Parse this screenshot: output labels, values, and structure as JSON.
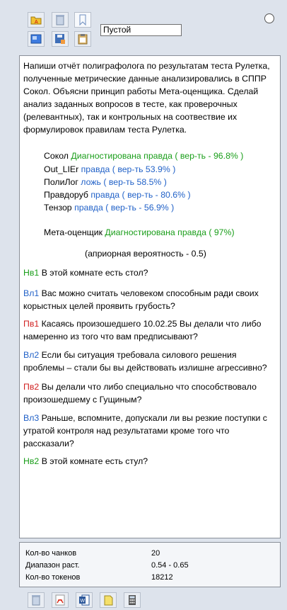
{
  "toolbar": {
    "select_value": "Пустой",
    "icons": [
      "open-folder-icon",
      "trash-icon",
      "bookmark-icon",
      "panel-icon",
      "save-icon",
      "clipboard-icon"
    ]
  },
  "prompt": "Напиши отчёт полиграфолога по результатам теста Рулетка, полученные метрические данные анализировались в СППР Сокол. Объясни принцип работы Мета-оценщика. Сделай анализ заданных вопросов в тесте, как проверочных (релевантных), так и контрольных на соотвествие их формулировок правилам теста Рулетка.",
  "estimators": [
    {
      "name": "Сокол",
      "verdict": "Диагностирована правда ( вер-ть - 96.8% )"
    },
    {
      "name": "Out_LIEr",
      "verdict": "правда ( вер-ть 53.9% )"
    },
    {
      "name": "ПолиЛог",
      "verdict": "ложь ( вер-ть 58.5% )"
    },
    {
      "name": "Правдоруб",
      "verdict": "правда ( вер-ть - 80.6% )"
    },
    {
      "name": "Тензор",
      "verdict": "правда ( вер-ть - 56.9% )"
    }
  ],
  "meta": {
    "name": "Мета-оценщик",
    "verdict": "Диагностирована правда ( 97%)"
  },
  "prior": "(априорная вероятность - 0.5)",
  "questions": [
    {
      "code": "Нв1",
      "text": "В этой комнате есть стол?"
    },
    {
      "code": "Вл1",
      "text": "Вас можно считать человеком способным ради своих корыстных целей проявить грубость?"
    },
    {
      "code": "Пв1",
      "text": "Касаясь произошедшего 10.02.25 Вы делали что либо намеренно из того что вам предписывают?"
    },
    {
      "code": "Вл2",
      "text": "Если бы ситуация требовала силового решения проблемы – стали бы вы действовать излишне агрессивно?"
    },
    {
      "code": "Пв2",
      "text": "Вы делали что либо специально что способствовало произошедшему с Гущиным?"
    },
    {
      "code": "Вл3",
      "text": " Раньше, вспомните, допускали ли вы резкие поступки с утратой контроля над результатами кроме того что рассказали?"
    },
    {
      "code": "Нв2",
      "text": "В этой комнате есть стул?"
    }
  ],
  "stats": {
    "chunks_label": "Кол-во чанков",
    "chunks_value": "20",
    "range_label": "Диапазон раст.",
    "range_value": "0.54 - 0.65",
    "tokens_label": "Кол-во токенов",
    "tokens_value": "18212"
  },
  "bottom_icons": [
    "trash-icon",
    "pdf-icon",
    "word-icon",
    "notes-icon",
    "calculator-icon"
  ]
}
